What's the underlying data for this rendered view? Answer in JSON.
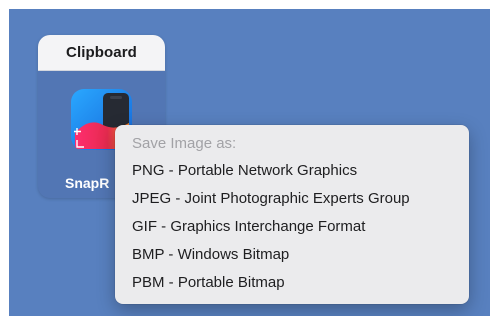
{
  "widget": {
    "title": "Clipboard",
    "app_name": "SnapR"
  },
  "context_menu": {
    "header": "Save Image as:",
    "items": [
      {
        "label": "PNG - Portable Network Graphics"
      },
      {
        "label": "JPEG - Joint Photographic Experts Group"
      },
      {
        "label": "GIF - Graphics Interchange Format"
      },
      {
        "label": "BMP - Windows Bitmap"
      },
      {
        "label": "PBM - Portable Bitmap"
      }
    ]
  },
  "colors": {
    "desktop_background": "#5880bf",
    "widget_body": "#5276b4",
    "menu_background": "#ebebed"
  },
  "icons": [
    "snapr-app-icon"
  ]
}
